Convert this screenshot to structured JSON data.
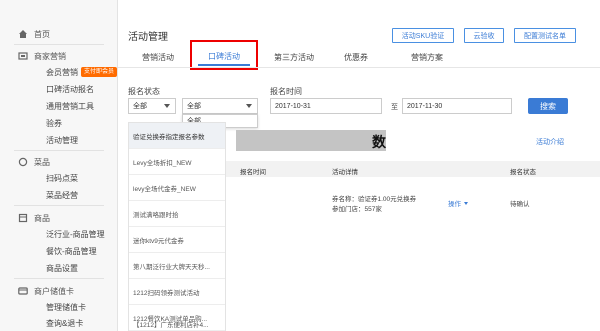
{
  "sidebar": {
    "items": [
      {
        "type": "head",
        "label": "首页",
        "icon": "home-icon"
      },
      {
        "type": "head",
        "label": "商家营销",
        "icon": "marketing-icon"
      },
      {
        "type": "sub",
        "label": "会员营销",
        "badge": "支付即会员"
      },
      {
        "type": "sub",
        "label": "口碑活动报名"
      },
      {
        "type": "sub",
        "label": "通用营销工具"
      },
      {
        "type": "sub",
        "label": "验券"
      },
      {
        "type": "sub",
        "label": "活动管理"
      },
      {
        "type": "head",
        "label": "菜品",
        "icon": "dish-icon"
      },
      {
        "type": "sub",
        "label": "扫码点菜"
      },
      {
        "type": "sub",
        "label": "菜品经营"
      },
      {
        "type": "head",
        "label": "商品",
        "icon": "goods-icon"
      },
      {
        "type": "sub",
        "label": "泛行业-商品管理"
      },
      {
        "type": "sub",
        "label": "餐饮-商品管理"
      },
      {
        "type": "sub",
        "label": "商品设置"
      },
      {
        "type": "head",
        "label": "商户储值卡",
        "icon": "card-icon"
      },
      {
        "type": "sub",
        "label": "管理储值卡"
      },
      {
        "type": "sub",
        "label": "查询&退卡"
      }
    ]
  },
  "header": {
    "title": "活动管理",
    "buttons": [
      "活动SKU验证",
      "云验收",
      "配置测试名单"
    ]
  },
  "tabs": [
    {
      "label": "营销活动",
      "active": false
    },
    {
      "label": "口碑活动",
      "active": true
    },
    {
      "label": "第三方活动",
      "active": false
    },
    {
      "label": "优惠券",
      "active": false
    },
    {
      "label": "营销方案",
      "active": false
    }
  ],
  "filters": {
    "status_label": "报名状态",
    "status_value": "全部",
    "type_value": "全部",
    "dropdown_option": "全部",
    "time_label": "报名时间",
    "date_start": "2017-10-31",
    "date_sep": "至",
    "date_end": "2017-11-30",
    "search_label": "搜索"
  },
  "activity_list": [
    "验证兑换券指定报名参数",
    "Levy全场折扣_NEW",
    "levy全场代金券_NEW",
    "测试满咯跟时拾",
    "迷你ktv9元代金券",
    "第八期泛行业大牌天天秒...",
    "1212扫码领券测试活动",
    "1212餐饮KA测试单品购...",
    "【1212】广东便利店补4..."
  ],
  "detail": {
    "title_suffix": "数",
    "intro_link": "活动介绍",
    "columns": [
      "报名时间",
      "活动详情",
      "报名状态"
    ],
    "row": {
      "detail_line1": "券名称：验证券1.00元兑换券",
      "detail_line2": "参加门店：557家",
      "operation": "操作",
      "status": "待确认"
    }
  },
  "colors": {
    "accent": "#3a7bd5",
    "highlight_box": "#e00000",
    "badge": "#ff6b00"
  }
}
